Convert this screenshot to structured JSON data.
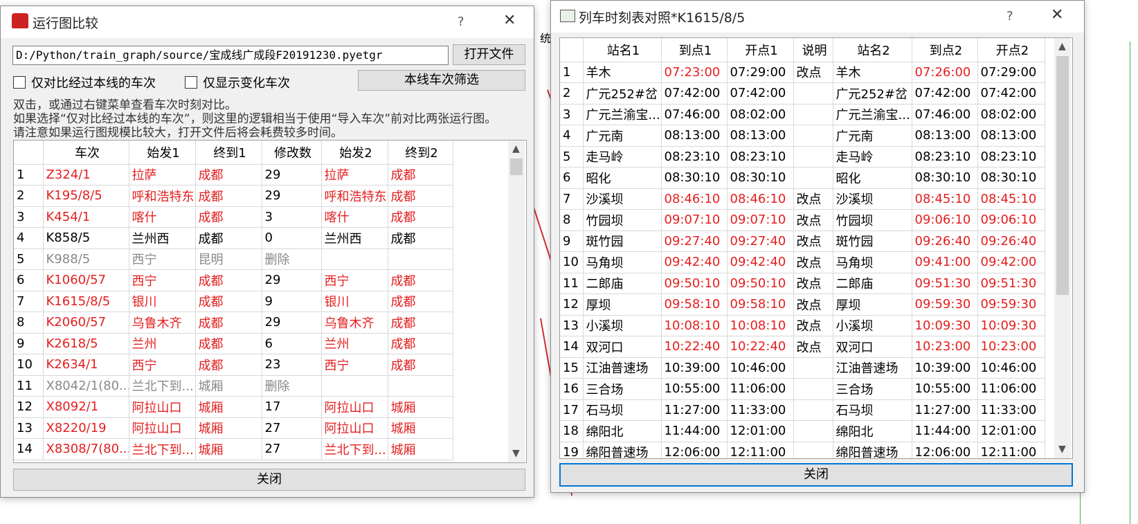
{
  "left_window": {
    "title": "运行图比较",
    "help": "?",
    "close": "✕",
    "path": "D:/Python/train_graph/source/宝成线广成段F20191230.pyetgr",
    "open_file": "打开文件",
    "check_only_line": "仅对比经过本线的车次",
    "check_only_changed": "仅显示变化车次",
    "filter_button": "本线车次筛选",
    "desc1": "双击，或通过右键菜单查看车次时刻对比。",
    "desc2": "如果选择“仅对比经过本线的车次”，则这里的逻辑相当于使用“导入车次”前对比两张运行图。",
    "desc3": "请注意如果运行图规模比较大，打开文件后将会耗费较多时间。",
    "headers": [
      "车次",
      "始发1",
      "终到1",
      "修改数",
      "始发2",
      "终到2"
    ],
    "rows": [
      {
        "n": "1",
        "c": [
          "Z324/1",
          "拉萨",
          "成都",
          "29",
          "拉萨",
          "成都"
        ],
        "s": "red"
      },
      {
        "n": "2",
        "c": [
          "K195/8/5",
          "呼和浩特东",
          "成都",
          "29",
          "呼和浩特东",
          "成都"
        ],
        "s": "red"
      },
      {
        "n": "3",
        "c": [
          "K454/1",
          "喀什",
          "成都",
          "3",
          "喀什",
          "成都"
        ],
        "s": "red"
      },
      {
        "n": "4",
        "c": [
          "K858/5",
          "兰州西",
          "成都",
          "0",
          "兰州西",
          "成都"
        ],
        "s": "black"
      },
      {
        "n": "5",
        "c": [
          "K988/5",
          "西宁",
          "昆明",
          "删除",
          "",
          ""
        ],
        "s": "gray"
      },
      {
        "n": "6",
        "c": [
          "K1060/57",
          "西宁",
          "成都",
          "29",
          "西宁",
          "成都"
        ],
        "s": "red"
      },
      {
        "n": "7",
        "c": [
          "K1615/8/5",
          "银川",
          "成都",
          "9",
          "银川",
          "成都"
        ],
        "s": "red"
      },
      {
        "n": "8",
        "c": [
          "K2060/57",
          "乌鲁木齐",
          "成都",
          "29",
          "乌鲁木齐",
          "成都"
        ],
        "s": "red"
      },
      {
        "n": "9",
        "c": [
          "K2618/5",
          "兰州",
          "成都",
          "6",
          "兰州",
          "成都"
        ],
        "s": "red"
      },
      {
        "n": "10",
        "c": [
          "K2634/1",
          "西宁",
          "成都",
          "23",
          "西宁",
          "成都"
        ],
        "s": "red"
      },
      {
        "n": "11",
        "c": [
          "X8042/1(80...",
          "兰北下到...",
          "城厢",
          "删除",
          "",
          ""
        ],
        "s": "gray"
      },
      {
        "n": "12",
        "c": [
          "X8092/1",
          "阿拉山口",
          "城厢",
          "17",
          "阿拉山口",
          "城厢"
        ],
        "s": "red"
      },
      {
        "n": "13",
        "c": [
          "X8220/19",
          "阿拉山口",
          "城厢",
          "27",
          "阿拉山口",
          "城厢"
        ],
        "s": "red"
      },
      {
        "n": "14",
        "c": [
          "X8308/7(80...",
          "兰北下到...",
          "城厢",
          "27",
          "兰北下到...",
          "城厢"
        ],
        "s": "red"
      }
    ],
    "close_button": "关闭"
  },
  "right_window": {
    "title": "列车时刻表对照*K1615/8/5",
    "help": "?",
    "close": "✕",
    "headers": [
      "站名1",
      "到点1",
      "开点1",
      "说明",
      "站名2",
      "到点2",
      "开点2"
    ],
    "rows": [
      {
        "n": "1",
        "c": [
          "羊木",
          "07:23:00",
          "07:29:00",
          "改点",
          "羊木",
          "07:26:00",
          "07:29:00"
        ],
        "r": [
          1,
          5
        ]
      },
      {
        "n": "2",
        "c": [
          "广元252#岔",
          "07:42:00",
          "07:42:00",
          "",
          "广元252#岔",
          "07:42:00",
          "07:42:00"
        ],
        "r": []
      },
      {
        "n": "3",
        "c": [
          "广元兰渝宝...",
          "07:46:00",
          "08:02:00",
          "",
          "广元兰渝宝...",
          "07:46:00",
          "08:02:00"
        ],
        "r": []
      },
      {
        "n": "4",
        "c": [
          "广元南",
          "08:13:00",
          "08:13:00",
          "",
          "广元南",
          "08:13:00",
          "08:13:00"
        ],
        "r": []
      },
      {
        "n": "5",
        "c": [
          "走马岭",
          "08:23:10",
          "08:23:10",
          "",
          "走马岭",
          "08:23:10",
          "08:23:10"
        ],
        "r": []
      },
      {
        "n": "6",
        "c": [
          "昭化",
          "08:30:10",
          "08:30:10",
          "",
          "昭化",
          "08:30:10",
          "08:30:10"
        ],
        "r": []
      },
      {
        "n": "7",
        "c": [
          "沙溪坝",
          "08:46:10",
          "08:46:10",
          "改点",
          "沙溪坝",
          "08:45:10",
          "08:45:10"
        ],
        "r": [
          1,
          2,
          5,
          6
        ]
      },
      {
        "n": "8",
        "c": [
          "竹园坝",
          "09:07:10",
          "09:07:10",
          "改点",
          "竹园坝",
          "09:06:10",
          "09:06:10"
        ],
        "r": [
          1,
          2,
          5,
          6
        ]
      },
      {
        "n": "9",
        "c": [
          "斑竹园",
          "09:27:40",
          "09:27:40",
          "改点",
          "斑竹园",
          "09:26:40",
          "09:26:40"
        ],
        "r": [
          1,
          2,
          5,
          6
        ]
      },
      {
        "n": "10",
        "c": [
          "马角坝",
          "09:42:40",
          "09:42:40",
          "改点",
          "马角坝",
          "09:41:00",
          "09:42:00"
        ],
        "r": [
          1,
          2,
          5,
          6
        ]
      },
      {
        "n": "11",
        "c": [
          "二郎庙",
          "09:50:10",
          "09:50:10",
          "改点",
          "二郎庙",
          "09:51:30",
          "09:51:30"
        ],
        "r": [
          1,
          2,
          5,
          6
        ]
      },
      {
        "n": "12",
        "c": [
          "厚坝",
          "09:58:10",
          "09:58:10",
          "改点",
          "厚坝",
          "09:59:30",
          "09:59:30"
        ],
        "r": [
          1,
          2,
          5,
          6
        ]
      },
      {
        "n": "13",
        "c": [
          "小溪坝",
          "10:08:10",
          "10:08:10",
          "改点",
          "小溪坝",
          "10:09:30",
          "10:09:30"
        ],
        "r": [
          1,
          2,
          5,
          6
        ]
      },
      {
        "n": "14",
        "c": [
          "双河口",
          "10:22:40",
          "10:22:40",
          "改点",
          "双河口",
          "10:23:00",
          "10:23:00"
        ],
        "r": [
          1,
          2,
          5,
          6
        ]
      },
      {
        "n": "15",
        "c": [
          "江油普速场",
          "10:39:00",
          "10:46:00",
          "",
          "江油普速场",
          "10:39:00",
          "10:46:00"
        ],
        "r": []
      },
      {
        "n": "16",
        "c": [
          "三合场",
          "10:55:00",
          "11:06:00",
          "",
          "三合场",
          "10:55:00",
          "11:06:00"
        ],
        "r": []
      },
      {
        "n": "17",
        "c": [
          "石马坝",
          "11:27:00",
          "11:33:00",
          "",
          "石马坝",
          "11:27:00",
          "11:33:00"
        ],
        "r": []
      },
      {
        "n": "18",
        "c": [
          "绵阳北",
          "11:44:00",
          "12:01:00",
          "",
          "绵阳北",
          "11:44:00",
          "12:01:00"
        ],
        "r": []
      },
      {
        "n": "19",
        "c": [
          "绵阳普速场",
          "12:06:00",
          "12:11:00",
          "",
          "绵阳普速场",
          "12:06:00",
          "12:11:00"
        ],
        "r": []
      }
    ],
    "close_button": "关闭"
  },
  "background": {
    "system_label": "统"
  }
}
